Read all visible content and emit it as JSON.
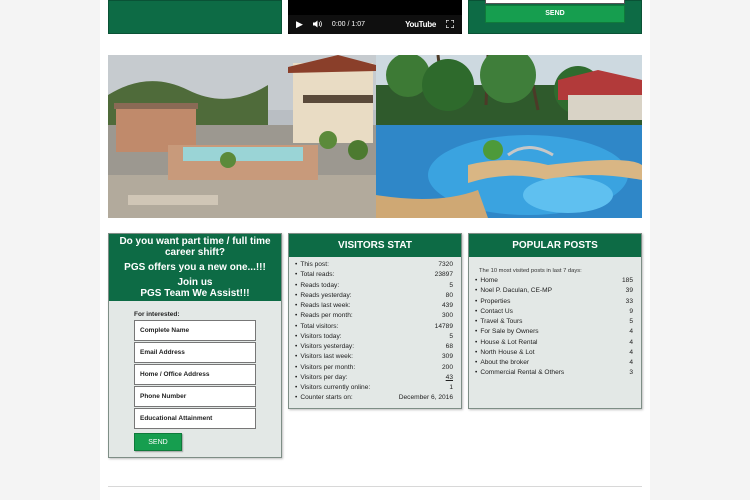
{
  "video": {
    "time": "0:00 / 1:07",
    "play_icon": "play-icon",
    "volume_icon": "volume-icon",
    "brand": "YouTube",
    "fullscreen_icon": "fullscreen-icon"
  },
  "top_form": {
    "send_label": "SEND"
  },
  "recruit": {
    "heading_line1": "Do you want part time / full time",
    "heading_line2": "career shift?",
    "heading_line3": "PGS offers you a new one...!!!",
    "heading_line4": "Join us",
    "heading_line5": "PGS Team We Assist!!!",
    "form_label": "For interested:",
    "fields": [
      "Complete Name",
      "Email Address",
      "Home / Office Address",
      "Phone Number",
      "Educational Attainment"
    ],
    "send_label": "SEND"
  },
  "visitors": {
    "title": "VISITORS STAT",
    "rows": [
      {
        "label": "This post:",
        "value": "7320"
      },
      {
        "label": "Total reads:",
        "value": "23897"
      },
      {
        "label": "Reads today:",
        "value": "5"
      },
      {
        "label": "Reads yesterday:",
        "value": "80"
      },
      {
        "label": "Reads last week:",
        "value": "439"
      },
      {
        "label": "Reads per month:",
        "value": "300"
      },
      {
        "label": "Total visitors:",
        "value": "14789"
      },
      {
        "label": "Visitors today:",
        "value": "5"
      },
      {
        "label": "Visitors yesterday:",
        "value": "68"
      },
      {
        "label": "Visitors last week:",
        "value": "309"
      },
      {
        "label": "Visitors per month:",
        "value": "200"
      },
      {
        "label": "Visitors per day:",
        "value": "43"
      },
      {
        "label": "Visitors currently online:",
        "value": "1"
      },
      {
        "label": "Counter starts on:",
        "value": "December 6, 2016"
      }
    ]
  },
  "popular": {
    "title": "POPULAR POSTS",
    "subtitle": "The 10 most visited posts in last 7 days:",
    "rows": [
      {
        "label": "Home",
        "value": "185"
      },
      {
        "label": "Noel P. Daculan, CE-MP",
        "value": "39"
      },
      {
        "label": "Properties",
        "value": "33"
      },
      {
        "label": "Contact Us",
        "value": "9"
      },
      {
        "label": "Travel & Tours",
        "value": "5"
      },
      {
        "label": "For Sale by Owners",
        "value": "4"
      },
      {
        "label": "House & Lot Rental",
        "value": "4"
      },
      {
        "label": "North House & Lot",
        "value": "4"
      },
      {
        "label": "About the broker",
        "value": "4"
      },
      {
        "label": "Commercial Rental & Others",
        "value": "3"
      }
    ]
  },
  "colors": {
    "brand_green": "#0d6b45",
    "button_green": "#169e4f",
    "panel_bg": "#e3e8e6"
  }
}
